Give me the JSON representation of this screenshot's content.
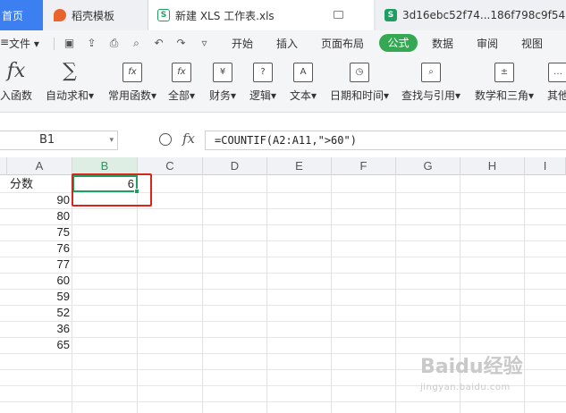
{
  "tabs": [
    {
      "label": "首页"
    },
    {
      "label": "稻壳模板"
    },
    {
      "label": "新建 XLS 工作表.xls"
    },
    {
      "label": "3d16ebc52f74...186f798c9f54"
    }
  ],
  "menu": {
    "file": "文件",
    "items": [
      "开始",
      "插入",
      "页面布局",
      "公式",
      "数据",
      "审阅",
      "视图"
    ],
    "active": "公式"
  },
  "ribbon": [
    {
      "label": "入函数",
      "icon": "fx-icon"
    },
    {
      "label": "自动求和▾",
      "icon": "sigma-icon"
    },
    {
      "label": "常用函数▾",
      "icon": "star-fx-icon"
    },
    {
      "label": "全部▾",
      "icon": "fx-box-icon"
    },
    {
      "label": "财务▾",
      "icon": "yen-icon"
    },
    {
      "label": "逻辑▾",
      "icon": "question-icon"
    },
    {
      "label": "文本▾",
      "icon": "text-a-icon"
    },
    {
      "label": "日期和时间▾",
      "icon": "clock-icon"
    },
    {
      "label": "查找与引用▾",
      "icon": "search-doc-icon"
    },
    {
      "label": "数学和三角▾",
      "icon": "math-icon"
    },
    {
      "label": "其他",
      "icon": "more-icon"
    }
  ],
  "formula_bar": {
    "name_box": "B1",
    "formula": "=COUNTIF(A2:A11,\">60\")"
  },
  "columns": [
    "A",
    "B",
    "C",
    "D",
    "E",
    "F",
    "G",
    "H",
    "I"
  ],
  "cells": {
    "A1": "分数",
    "B1": "6",
    "A_values": [
      "90",
      "80",
      "75",
      "76",
      "77",
      "60",
      "59",
      "52",
      "36",
      "65"
    ]
  },
  "watermark": {
    "text": "Baidu经验",
    "sub": "jingyan.baidu.com"
  }
}
